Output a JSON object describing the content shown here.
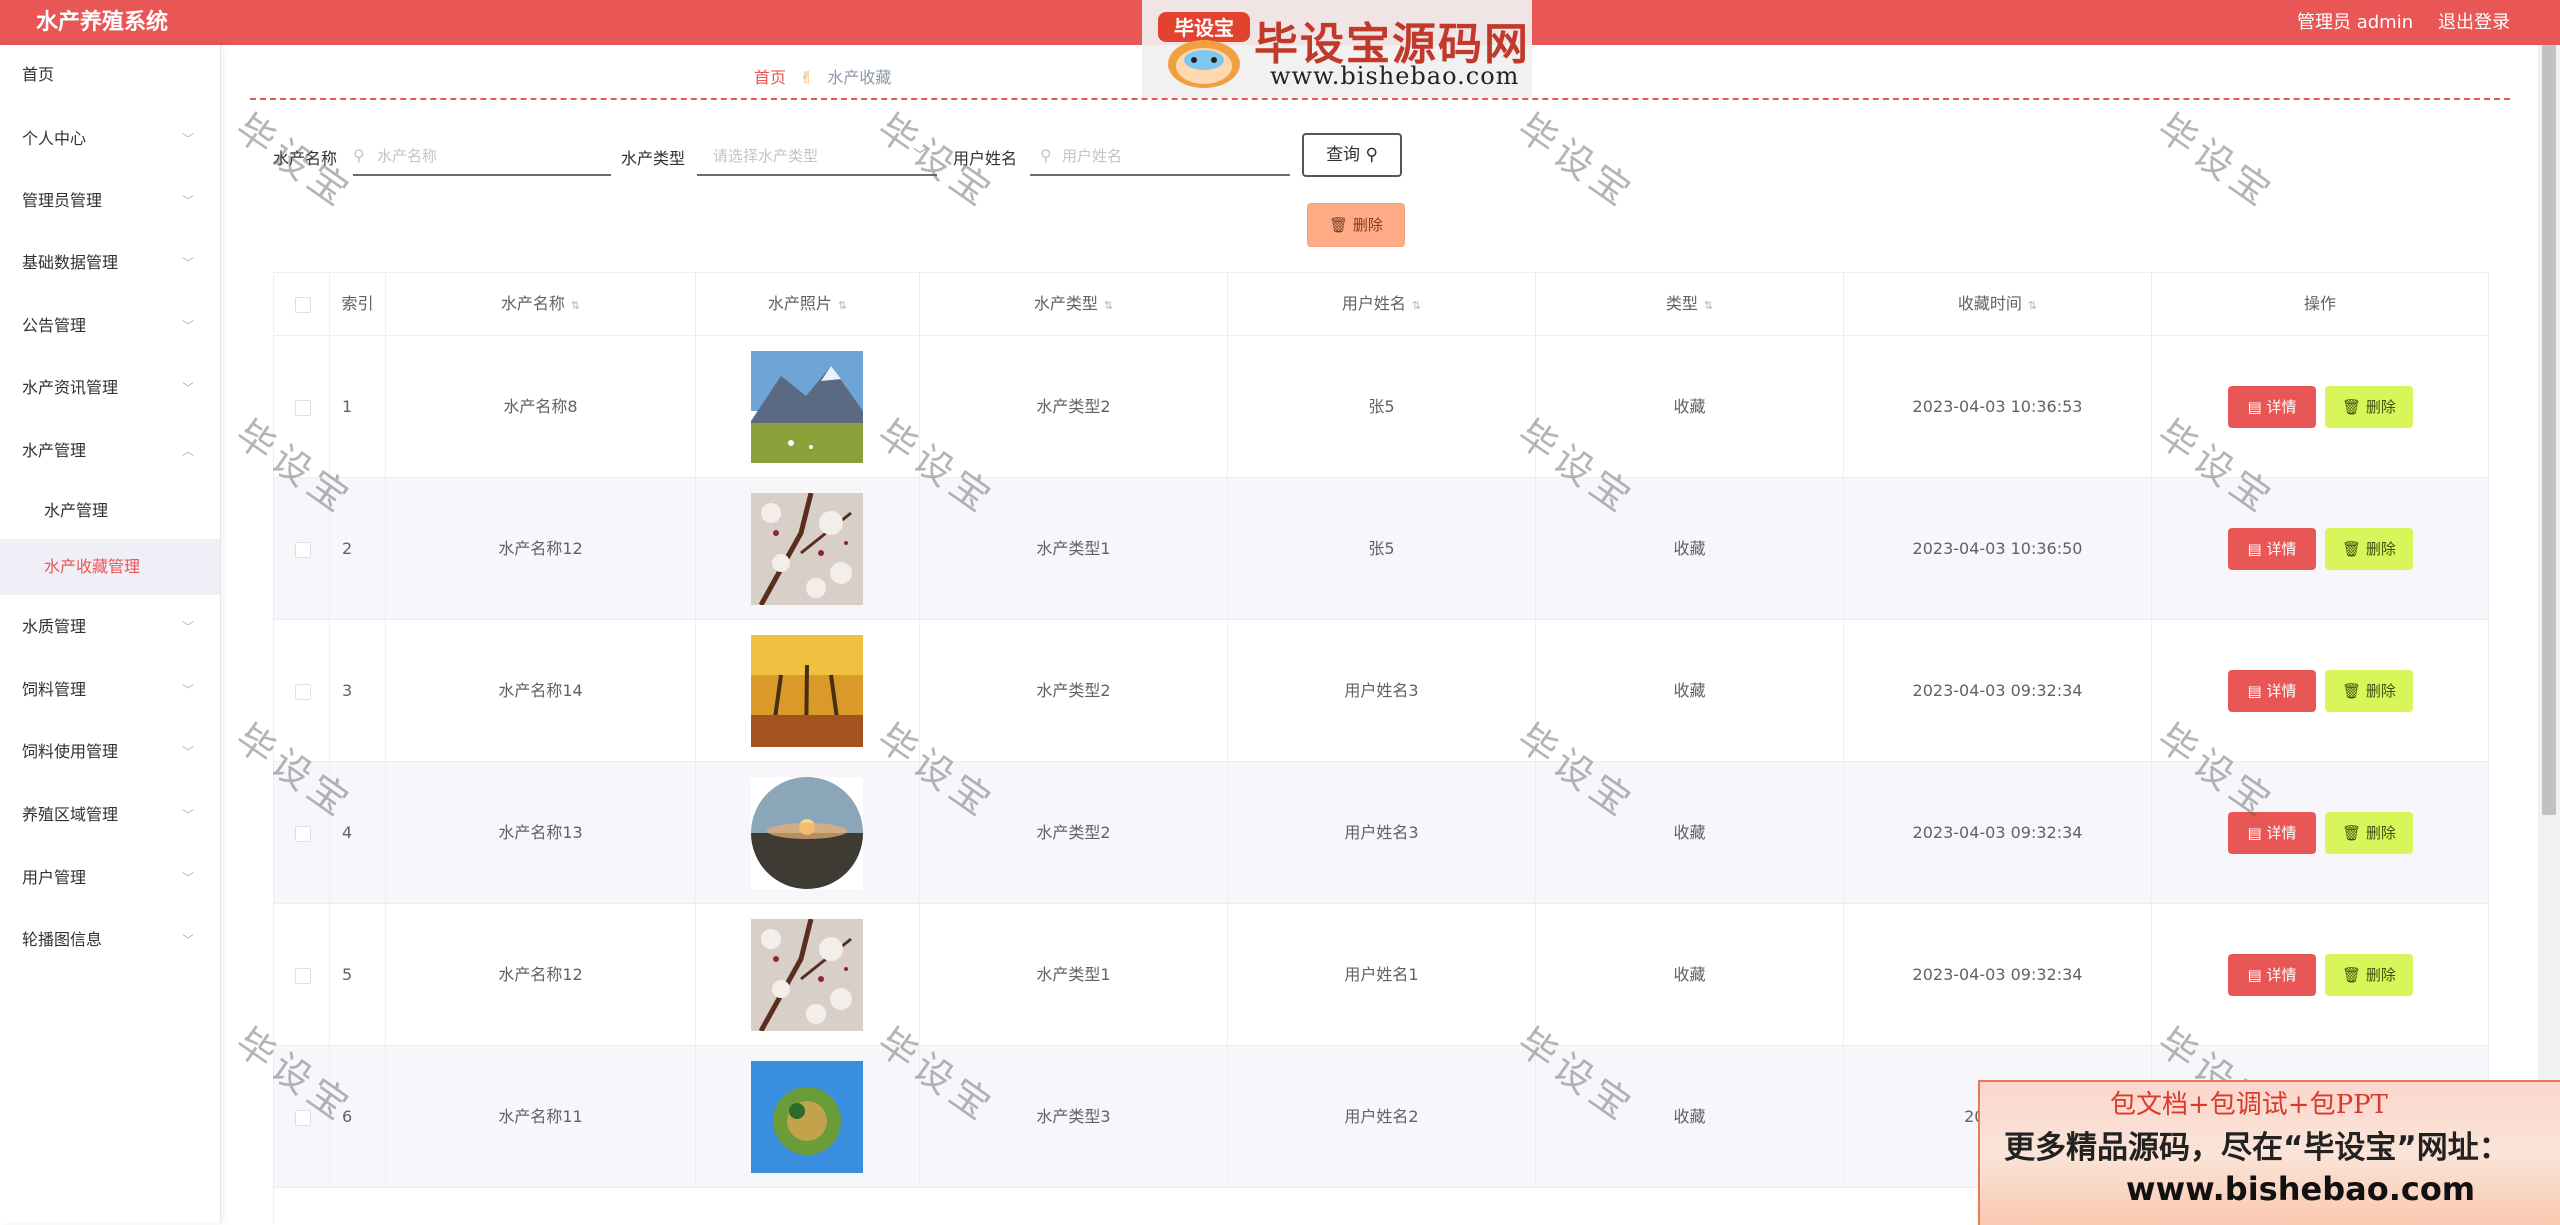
{
  "header": {
    "app_title": "水产养殖系统",
    "user_label": "管理员 admin",
    "logout_label": "退出登录"
  },
  "brand_logo": {
    "badge_text": "毕设宝",
    "name": "毕设宝源码网",
    "url": "www.bishebao.com"
  },
  "sidebar": {
    "items": [
      {
        "label": "首页"
      },
      {
        "label": "个人中心"
      },
      {
        "label": "管理员管理"
      },
      {
        "label": "基础数据管理"
      },
      {
        "label": "公告管理"
      },
      {
        "label": "水产资讯管理"
      },
      {
        "label": "水产管理"
      },
      {
        "label": "水质管理"
      },
      {
        "label": "饲料管理"
      },
      {
        "label": "饲料使用管理"
      },
      {
        "label": "养殖区域管理"
      },
      {
        "label": "用户管理"
      },
      {
        "label": "轮播图信息"
      }
    ],
    "sub_items": [
      {
        "label": "水产管理"
      },
      {
        "label": "水产收藏管理"
      }
    ]
  },
  "breadcrumb": {
    "home": "首页",
    "current": "水产收藏"
  },
  "search": {
    "name_label": "水产名称",
    "name_placeholder": "水产名称",
    "type_label": "水产类型",
    "type_placeholder": "请选择水产类型",
    "user_label": "用户姓名",
    "user_placeholder": "用户姓名",
    "query_button": "查询",
    "delete_button": "删除"
  },
  "table": {
    "columns": [
      "索引",
      "水产名称",
      "水产照片",
      "水产类型",
      "用户姓名",
      "类型",
      "收藏时间",
      "操作"
    ],
    "rows": [
      {
        "index": "1",
        "name": "水产名称8",
        "type": "水产类型2",
        "user": "张5",
        "kind": "收藏",
        "time": "2023-04-03 10:36:53",
        "photo": "mountain"
      },
      {
        "index": "2",
        "name": "水产名称12",
        "type": "水产类型1",
        "user": "张5",
        "kind": "收藏",
        "time": "2023-04-03 10:36:50",
        "photo": "blossom"
      },
      {
        "index": "3",
        "name": "水产名称14",
        "type": "水产类型2",
        "user": "用户姓名3",
        "kind": "收藏",
        "time": "2023-04-03 09:32:34",
        "photo": "autumn"
      },
      {
        "index": "4",
        "name": "水产名称13",
        "type": "水产类型2",
        "user": "用户姓名3",
        "kind": "收藏",
        "time": "2023-04-03 09:32:34",
        "photo": "sunset"
      },
      {
        "index": "5",
        "name": "水产名称12",
        "type": "水产类型1",
        "user": "用户姓名1",
        "kind": "收藏",
        "time": "2023-04-03 09:32:34",
        "photo": "blossom"
      },
      {
        "index": "6",
        "name": "水产名称11",
        "type": "水产类型3",
        "user": "用户姓名2",
        "kind": "收藏",
        "time": "2023-04",
        "photo": "planet"
      }
    ],
    "detail_label": "详情",
    "delete_label": "删除"
  },
  "watermark": {
    "text": "毕设宝"
  },
  "ad_banner": {
    "line1": "包文档+包调试+包PPT",
    "line2": "更多精品源码，尽在“毕设宝”网址：",
    "line3": "www.bishebao.com"
  },
  "colors": {
    "primary": "#e85656",
    "delete_accent": "#d8f55a",
    "delete_top": "#ffab86"
  }
}
